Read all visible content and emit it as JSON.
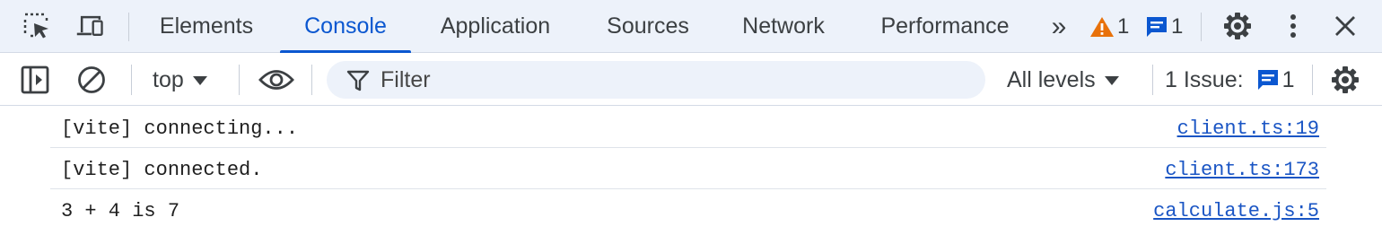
{
  "tabbar": {
    "tabs": [
      {
        "label": "Elements"
      },
      {
        "label": "Console"
      },
      {
        "label": "Application"
      },
      {
        "label": "Sources"
      },
      {
        "label": "Network"
      },
      {
        "label": "Performance"
      }
    ],
    "active_tab": "Console",
    "more_tabs_glyph": "»",
    "warnings_count": "1",
    "messages_count": "1"
  },
  "toolbar": {
    "context": "top",
    "filter_placeholder": "Filter",
    "levels": "All levels",
    "issues_label": "1 Issue:",
    "issues_count": "1"
  },
  "console": {
    "messages": [
      {
        "text": "[vite] connecting...",
        "source": "client.ts:19"
      },
      {
        "text": "[vite] connected.",
        "source": "client.ts:173"
      },
      {
        "text": "3 + 4 is 7",
        "source": "calculate.js:5"
      }
    ]
  },
  "colors": {
    "accent": "#0b57d0",
    "warning": "#e8710a",
    "link": "#1a55c4",
    "tabbar_bg": "#edf2fa"
  }
}
